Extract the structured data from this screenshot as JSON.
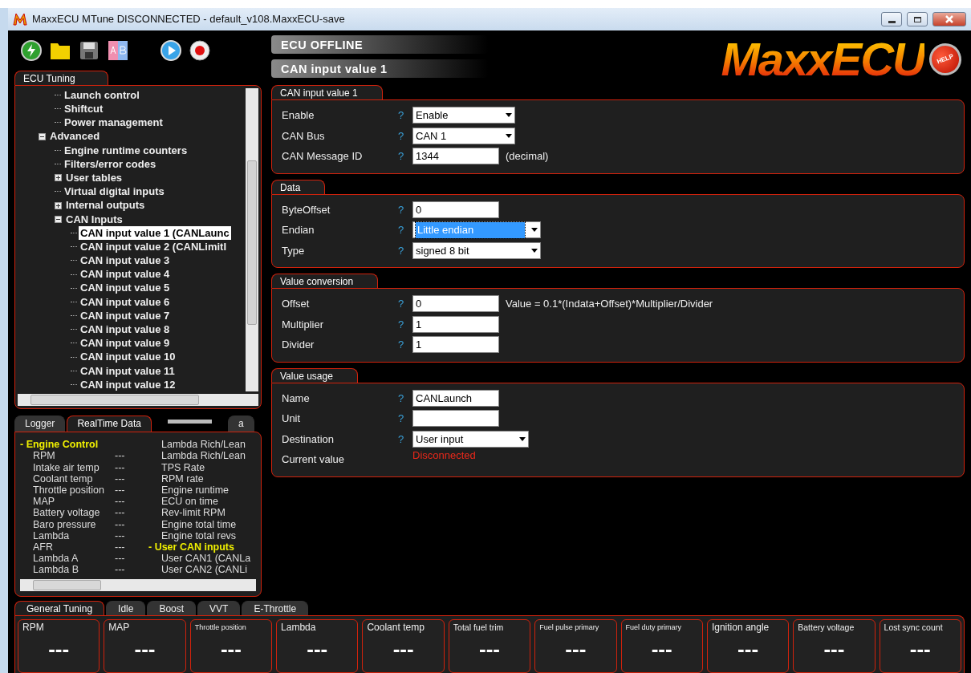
{
  "window": {
    "title": "MaxxECU MTune DISCONNECTED - default_v108.MaxxECU-save"
  },
  "banners": [
    "ECU OFFLINE",
    "CAN input value 1"
  ],
  "logo": {
    "text": "MaxxECU",
    "help_button": "HELP"
  },
  "tuning_panel": {
    "tab": "ECU Tuning",
    "tree": [
      {
        "children": [
          {
            "label": "Launch control",
            "selected": false
          },
          {
            "label": "Shiftcut",
            "selected": false
          },
          {
            "label": "Power management",
            "selected": false
          }
        ]
      },
      {
        "label": "Advanced",
        "selected": false,
        "expanded": true,
        "children": [
          {
            "label": "Engine runtime counters",
            "selected": false
          },
          {
            "label": "Filters/error codes",
            "selected": false
          },
          {
            "label": "User tables",
            "selected": false,
            "expanded": false
          },
          {
            "label": "Virtual digital inputs",
            "selected": false
          },
          {
            "label": "Internal outputs",
            "selected": false,
            "expanded": false
          },
          {
            "label": "CAN Inputs",
            "selected": false,
            "expanded": true,
            "children": [
              {
                "label": "CAN input value 1 (CANLaunc",
                "selected": true
              },
              {
                "label": "CAN input value 2 (CANLimitI",
                "selected": false
              },
              {
                "label": "CAN input value 3",
                "selected": false
              },
              {
                "label": "CAN input value 4",
                "selected": false
              },
              {
                "label": "CAN input value 5",
                "selected": false
              },
              {
                "label": "CAN input value 6",
                "selected": false
              },
              {
                "label": "CAN input value 7",
                "selected": false
              },
              {
                "label": "CAN input value 8",
                "selected": false
              },
              {
                "label": "CAN input value 9",
                "selected": false
              },
              {
                "label": "CAN input value 10",
                "selected": false
              },
              {
                "label": "CAN input value 11",
                "selected": false
              },
              {
                "label": "CAN input value 12",
                "selected": false
              }
            ]
          }
        ]
      }
    ]
  },
  "sections": [
    {
      "title": "CAN input value 1",
      "fields": [
        {
          "kind": "select",
          "label": "Enable",
          "help": "?",
          "value": "Enable",
          "focused": false
        },
        {
          "kind": "select",
          "label": "CAN Bus",
          "help": "?",
          "value": "CAN 1",
          "focused": false
        },
        {
          "kind": "input",
          "label": "CAN Message ID",
          "help": "?",
          "value": "1344",
          "suffix": "(decimal)",
          "focused": false
        }
      ]
    },
    {
      "title": "Data",
      "fields": [
        {
          "kind": "input",
          "label": "ByteOffset",
          "help": "?",
          "value": "0",
          "focused": false
        },
        {
          "kind": "select",
          "label": "Endian",
          "help": "?",
          "value": "Little endian",
          "focused": true
        },
        {
          "kind": "select",
          "label": "Type",
          "help": "?",
          "value": "signed 8 bit",
          "focused": false
        }
      ]
    },
    {
      "title": "Value conversion",
      "fields": [
        {
          "kind": "input",
          "label": "Offset",
          "help": "?",
          "value": "0",
          "suffix": "Value = 0.1*(Indata+Offset)*Multiplier/Divider",
          "focused": false
        },
        {
          "kind": "input",
          "label": "Multiplier",
          "help": "?",
          "value": "1",
          "focused": false
        },
        {
          "kind": "input",
          "label": "Divider",
          "help": "?",
          "value": "1",
          "focused": false
        }
      ]
    },
    {
      "title": "Value usage",
      "fields": [
        {
          "kind": "input",
          "label": "Name",
          "help": "?",
          "value": "CANLaunch",
          "focused": false
        },
        {
          "kind": "input",
          "label": "Unit",
          "help": "?",
          "focused": false
        },
        {
          "kind": "select",
          "label": "Destination",
          "help": "?",
          "value": "User input",
          "focused": false
        },
        {
          "kind": "status",
          "label": "Current value",
          "value": "Disconnected"
        }
      ]
    }
  ],
  "realtime_panel": {
    "tabs": [
      {
        "label": "Logger",
        "selected": false
      },
      {
        "label": "RealTime Data",
        "selected": true
      },
      {
        "label": "a",
        "selected": false
      }
    ],
    "columns": [
      [
        {
          "kind": "group",
          "label": "- Engine Control"
        },
        {
          "kind": "value",
          "label": "RPM",
          "value": "---"
        },
        {
          "kind": "value",
          "label": "Intake air temp",
          "value": "---"
        },
        {
          "kind": "value",
          "label": "Coolant temp",
          "value": "---"
        },
        {
          "kind": "value",
          "label": "Throttle position",
          "value": "---"
        },
        {
          "kind": "value",
          "label": "MAP",
          "value": "---"
        },
        {
          "kind": "value",
          "label": "Battery voltage",
          "value": "---"
        },
        {
          "kind": "value",
          "label": "Baro pressure",
          "value": "---"
        },
        {
          "kind": "value",
          "label": "Lambda",
          "value": "---"
        },
        {
          "kind": "value",
          "label": "AFR",
          "value": "---"
        },
        {
          "kind": "value",
          "label": "Lambda A",
          "value": "---"
        },
        {
          "kind": "value",
          "label": "Lambda B",
          "value": "---"
        }
      ],
      [
        {
          "kind": "value",
          "label": "Lambda Rich/Lean"
        },
        {
          "kind": "value",
          "label": "Lambda Rich/Lean"
        },
        {
          "kind": "value",
          "label": "TPS Rate"
        },
        {
          "kind": "value",
          "label": "RPM rate"
        },
        {
          "kind": "value",
          "label": "Engine runtime"
        },
        {
          "kind": "value",
          "label": "ECU on time"
        },
        {
          "kind": "value",
          "label": "Rev-limit RPM"
        },
        {
          "kind": "value",
          "label": "Engine total time"
        },
        {
          "kind": "value",
          "label": "Engine total revs"
        },
        {
          "kind": "group",
          "label": "- User CAN inputs"
        },
        {
          "kind": "value",
          "label": "User CAN1 (CANLa"
        },
        {
          "kind": "value",
          "label": "User CAN2 (CANLi"
        }
      ]
    ]
  },
  "gauge_panel": {
    "tabs": [
      {
        "label": "General Tuning",
        "selected": true
      },
      {
        "label": "Idle",
        "selected": false
      },
      {
        "label": "Boost",
        "selected": false
      },
      {
        "label": "VVT",
        "selected": false
      },
      {
        "label": "E-Throttle",
        "selected": false
      }
    ],
    "gauges": [
      {
        "title": "RPM",
        "value": "---"
      },
      {
        "title": "MAP",
        "value": "---"
      },
      {
        "title": "Throttle position",
        "value": "---"
      },
      {
        "title": "Lambda",
        "value": "---"
      },
      {
        "title": "Coolant temp",
        "value": "---"
      },
      {
        "title": "Total fuel trim",
        "value": "---"
      },
      {
        "title": "Fuel pulse primary",
        "value": "---"
      },
      {
        "title": "Fuel duty primary",
        "value": "---"
      },
      {
        "title": "Ignition angle",
        "value": "---"
      },
      {
        "title": "Battery voltage",
        "value": "---"
      },
      {
        "title": "Lost sync count",
        "value": "---"
      }
    ]
  }
}
